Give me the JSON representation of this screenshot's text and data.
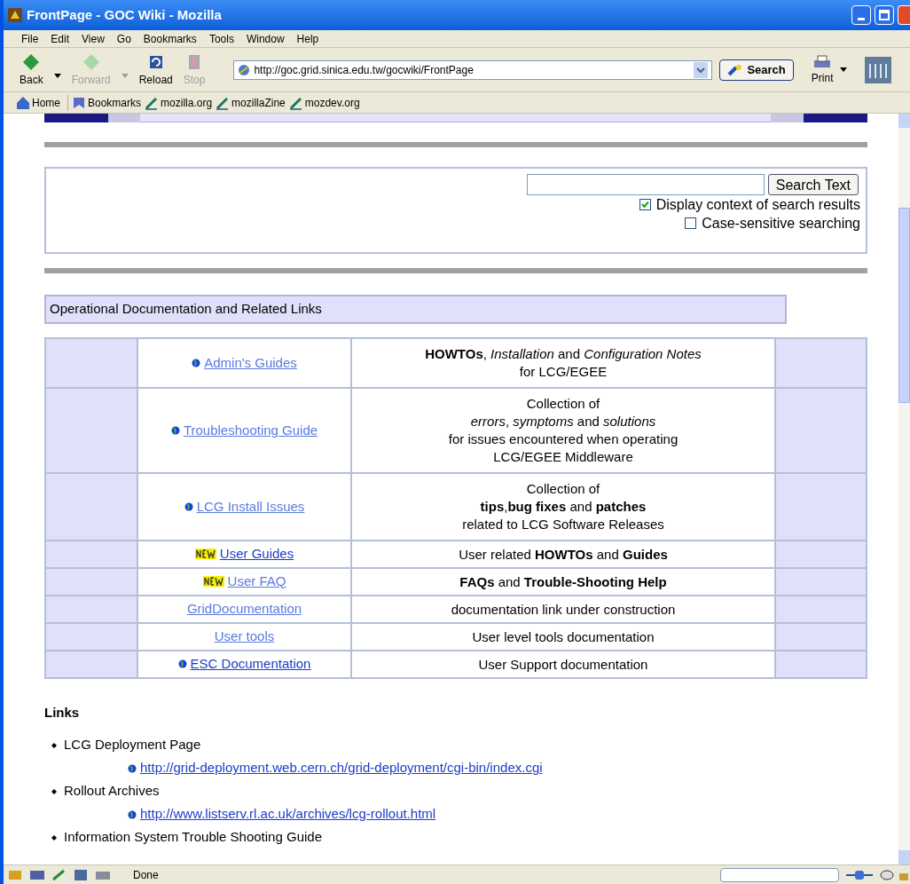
{
  "window": {
    "title": "FrontPage - GOC Wiki - Mozilla"
  },
  "menu": [
    "File",
    "Edit",
    "View",
    "Go",
    "Bookmarks",
    "Tools",
    "Window",
    "Help"
  ],
  "toolbar": [
    {
      "label": "Back",
      "kind": "back",
      "disabled": false,
      "dropdown": true
    },
    {
      "label": "Forward",
      "kind": "forward",
      "disabled": true,
      "dropdown": true
    },
    {
      "label": "Reload",
      "kind": "reload",
      "disabled": false,
      "dropdown": false
    },
    {
      "label": "Stop",
      "kind": "stop",
      "disabled": true,
      "dropdown": false
    }
  ],
  "address": {
    "value": "http://goc.grid.sinica.edu.tw/gocwiki/FrontPage"
  },
  "search_button": "Search",
  "print_button": "Print",
  "personal_bar": [
    {
      "label": "Home",
      "kind": "home"
    },
    {
      "label": "Bookmarks",
      "kind": "bookmarks"
    },
    {
      "label": "mozilla.org",
      "kind": "link"
    },
    {
      "label": "mozillaZine",
      "kind": "link"
    },
    {
      "label": "mozdev.org",
      "kind": "link"
    }
  ],
  "search_form": {
    "button": "Search Text",
    "options": [
      {
        "label": "Display context of search results",
        "checked": true
      },
      {
        "label": "Case-sensitive searching",
        "checked": false
      }
    ]
  },
  "section_heading": "Operational Documentation and Related Links",
  "docs_table": {
    "rows": [
      {
        "kind": "globe",
        "link": "Admin's Guides",
        "visited": true,
        "description": [
          "**HOWTOs**, *Installation* and *Configuration Notes*",
          "for LCG/EGEE"
        ]
      },
      {
        "kind": "globe",
        "link": "Troubleshooting Guide",
        "visited": true,
        "description": [
          "Collection of",
          "*errors*, *symptoms* and *solutions*",
          "for issues encountered when operating",
          "LCG/EGEE Middleware"
        ]
      },
      {
        "kind": "globe",
        "link": "LCG Install Issues",
        "visited": true,
        "description": [
          "Collection of",
          "**tips**,**bug fixes** and **patches**",
          "related to LCG Software Releases"
        ]
      },
      {
        "kind": "new",
        "link": "User Guides",
        "visited": false,
        "description": [
          "User related **HOWTOs** and **Guides**"
        ]
      },
      {
        "kind": "new",
        "link": "User FAQ",
        "visited": true,
        "description": [
          "**FAQs** and **Trouble-Shooting Help**"
        ]
      },
      {
        "kind": "plain",
        "link": "GridDocumentation",
        "visited": true,
        "description": [
          "documentation link under construction"
        ]
      },
      {
        "kind": "plain",
        "link": "User tools",
        "visited": true,
        "description": [
          "User level tools documentation"
        ]
      },
      {
        "kind": "globe",
        "link": "ESC Documentation",
        "visited": false,
        "description": [
          "User Support documentation"
        ]
      }
    ]
  },
  "links": {
    "heading": "Links",
    "items": [
      {
        "label": "LCG Deployment Page",
        "url": "http://grid-deployment.web.cern.ch/grid-deployment/cgi-bin/index.cgi"
      },
      {
        "label": "Rollout Archives",
        "url": "http://www.listserv.rl.ac.uk/archives/lcg-rollout.html"
      },
      {
        "label": "Information System Trouble Shooting Guide"
      }
    ]
  },
  "status_bar": {
    "text": "Done"
  }
}
